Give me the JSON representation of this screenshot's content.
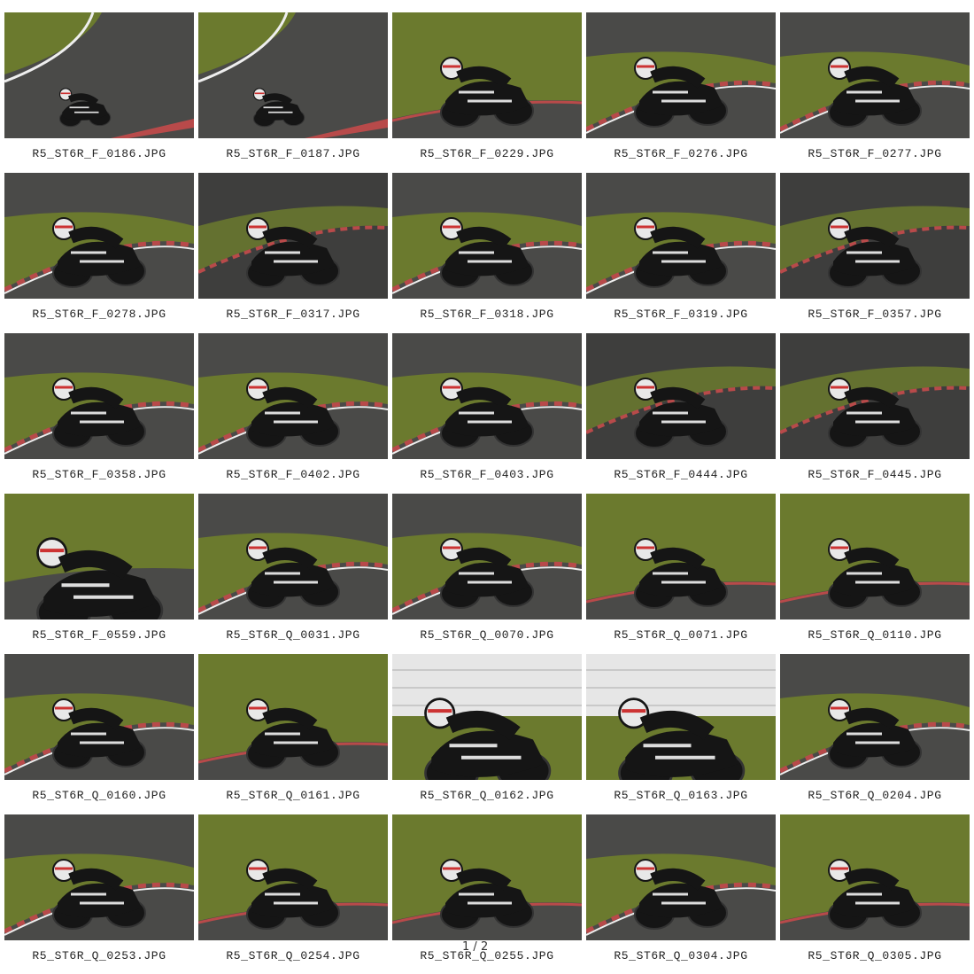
{
  "gallery": {
    "items": [
      {
        "filename": "R5_ST6R_F_0186.JPG",
        "scene": "far"
      },
      {
        "filename": "R5_ST6R_F_0187.JPG",
        "scene": "far"
      },
      {
        "filename": "R5_ST6R_F_0229.JPG",
        "scene": "grass"
      },
      {
        "filename": "R5_ST6R_F_0276.JPG",
        "scene": "curb"
      },
      {
        "filename": "R5_ST6R_F_0277.JPG",
        "scene": "curb"
      },
      {
        "filename": "R5_ST6R_F_0278.JPG",
        "scene": "curb"
      },
      {
        "filename": "R5_ST6R_F_0317.JPG",
        "scene": "dark"
      },
      {
        "filename": "R5_ST6R_F_0318.JPG",
        "scene": "curb"
      },
      {
        "filename": "R5_ST6R_F_0319.JPG",
        "scene": "curb"
      },
      {
        "filename": "R5_ST6R_F_0357.JPG",
        "scene": "dark"
      },
      {
        "filename": "R5_ST6R_F_0358.JPG",
        "scene": "curb"
      },
      {
        "filename": "R5_ST6R_F_0402.JPG",
        "scene": "curb"
      },
      {
        "filename": "R5_ST6R_F_0403.JPG",
        "scene": "curb"
      },
      {
        "filename": "R5_ST6R_F_0444.JPG",
        "scene": "dark"
      },
      {
        "filename": "R5_ST6R_F_0445.JPG",
        "scene": "dark"
      },
      {
        "filename": "R5_ST6R_F_0559.JPG",
        "scene": "close"
      },
      {
        "filename": "R5_ST6R_Q_0031.JPG",
        "scene": "curb"
      },
      {
        "filename": "R5_ST6R_Q_0070.JPG",
        "scene": "curb"
      },
      {
        "filename": "R5_ST6R_Q_0071.JPG",
        "scene": "grass"
      },
      {
        "filename": "R5_ST6R_Q_0110.JPG",
        "scene": "grass"
      },
      {
        "filename": "R5_ST6R_Q_0160.JPG",
        "scene": "curb"
      },
      {
        "filename": "R5_ST6R_Q_0161.JPG",
        "scene": "grass"
      },
      {
        "filename": "R5_ST6R_Q_0162.JPG",
        "scene": "wall"
      },
      {
        "filename": "R5_ST6R_Q_0163.JPG",
        "scene": "wall"
      },
      {
        "filename": "R5_ST6R_Q_0204.JPG",
        "scene": "curb"
      },
      {
        "filename": "R5_ST6R_Q_0253.JPG",
        "scene": "curb"
      },
      {
        "filename": "R5_ST6R_Q_0254.JPG",
        "scene": "grass"
      },
      {
        "filename": "R5_ST6R_Q_0255.JPG",
        "scene": "grass"
      },
      {
        "filename": "R5_ST6R_Q_0304.JPG",
        "scene": "curb"
      },
      {
        "filename": "R5_ST6R_Q_0305.JPG",
        "scene": "grass"
      }
    ]
  },
  "pagination": {
    "page_1": "1",
    "separator": "/",
    "page_2": "2"
  },
  "colors": {
    "asphalt": "#4a4a48",
    "grass": "#6b7a2e",
    "curb_red": "#b84a4a",
    "curb_white": "#eeeeee",
    "bike": "#151515",
    "wall": "#e6e6e6"
  }
}
